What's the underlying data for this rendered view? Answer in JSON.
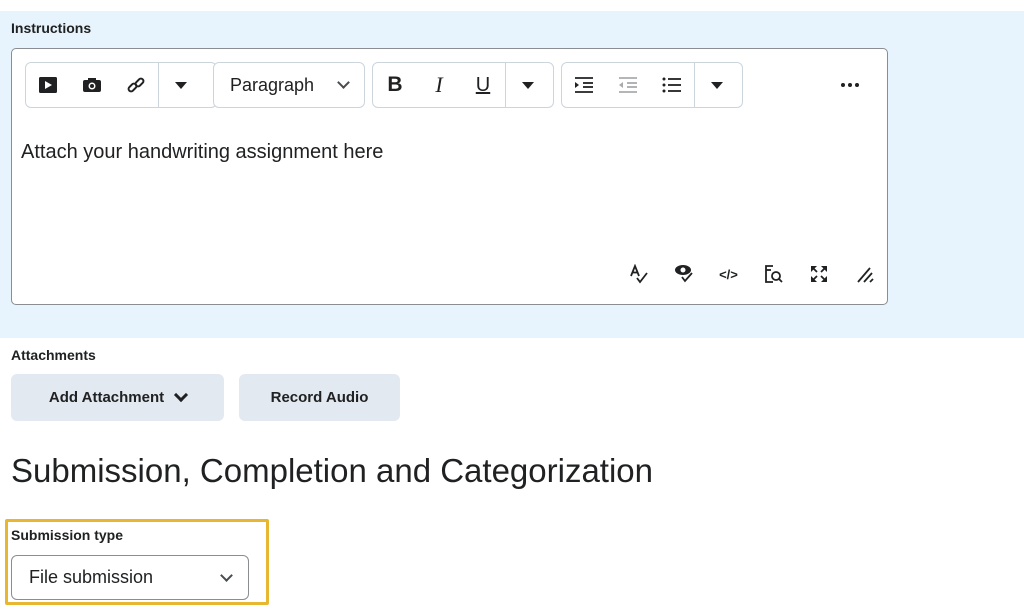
{
  "instructions": {
    "label": "Instructions",
    "toolbar": {
      "insert_group": [
        "insert-video",
        "insert-camera",
        "insert-link"
      ],
      "format_select": "Paragraph",
      "bold": "B",
      "italic": "I",
      "underline": "U"
    },
    "content": "Attach your handwriting assignment here",
    "bottom_tools": [
      "spellcheck-icon",
      "accessibility-checker-icon",
      "source-code-icon",
      "preview-icon",
      "fullscreen-icon",
      "resize-icon"
    ]
  },
  "attachments": {
    "label": "Attachments",
    "add_attachment": "Add Attachment",
    "record_audio": "Record Audio"
  },
  "section": {
    "title": "Submission, Completion and Categorization"
  },
  "submission_type": {
    "label": "Submission type",
    "value": "File submission"
  },
  "colors": {
    "panel_bg": "#e8f4fd",
    "button_bg": "#e3e9f1",
    "highlight": "#e8b731"
  }
}
